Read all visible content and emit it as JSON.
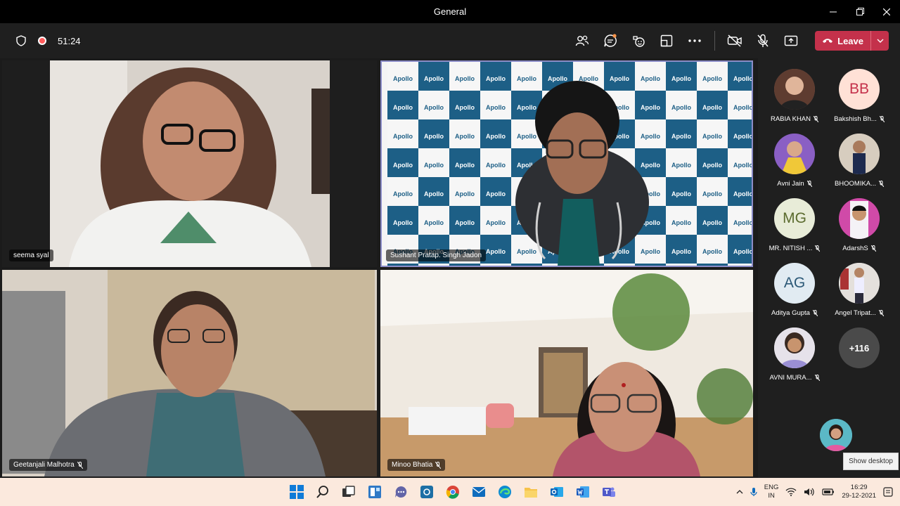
{
  "window": {
    "title": "General"
  },
  "toolbar": {
    "timer": "51:24",
    "leave_label": "Leave"
  },
  "tiles": [
    {
      "name": "seema syal"
    },
    {
      "name": "Sushant Pratap. Singh Jadon"
    },
    {
      "name": "Geetanjali Malhotra"
    },
    {
      "name": "Minoo Bhatia"
    }
  ],
  "roster": {
    "people": [
      {
        "name": "RABIA KHAN",
        "initials": ""
      },
      {
        "name": "Bakshish Bh...",
        "initials": "BB"
      },
      {
        "name": "Avni Jain",
        "initials": ""
      },
      {
        "name": "BHOOMIKA...",
        "initials": ""
      },
      {
        "name": "MR. NITISH ...",
        "initials": "MG"
      },
      {
        "name": "AdarshS",
        "initials": ""
      },
      {
        "name": "Aditya Gupta",
        "initials": "AG"
      },
      {
        "name": "Angel Tripat...",
        "initials": ""
      },
      {
        "name": "AVNI MURA...",
        "initials": ""
      }
    ],
    "more_count": "+116",
    "tooltip": "Show desktop"
  },
  "taskbar": {
    "lang_top": "ENG",
    "lang_bottom": "IN",
    "time": "16:29",
    "date": "29-12-2021"
  },
  "backdrop": {
    "brand_name": "Apollo"
  },
  "colors": {
    "leave": "#c4314b",
    "active_border": "#8b8cc7",
    "taskbar": "#fbe9dd"
  }
}
